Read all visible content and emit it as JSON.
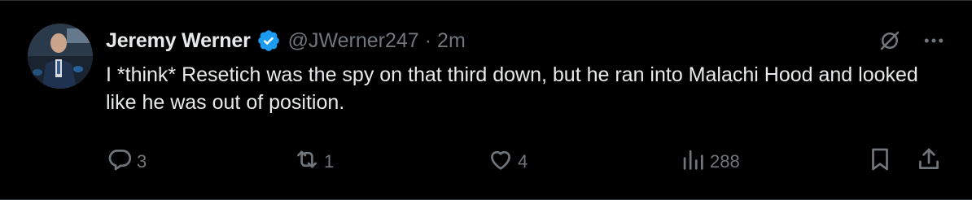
{
  "author": {
    "name": "Jeremy Werner",
    "handle": "@JWerner247",
    "separator": "·",
    "timestamp": "2m",
    "verified": true,
    "verified_color": "#1d9bf0"
  },
  "tweet": {
    "text": "I *think* Resetich was the spy on that third down, but he ran into Malachi Hood and looked like he was out of position."
  },
  "top_icons": [
    "grok-icon",
    "more-icon"
  ],
  "actions": {
    "reply": {
      "icon": "reply-icon",
      "count": "3"
    },
    "retweet": {
      "icon": "retweet-icon",
      "count": "1"
    },
    "like": {
      "icon": "heart-icon",
      "count": "4"
    },
    "views": {
      "icon": "views-icon",
      "count": "288"
    },
    "bookmark": {
      "icon": "bookmark-icon"
    },
    "share": {
      "icon": "share-icon"
    }
  },
  "colors": {
    "background": "#000000",
    "text_primary": "#e7e9ea",
    "text_secondary": "#71767b",
    "accent": "#1d9bf0"
  }
}
